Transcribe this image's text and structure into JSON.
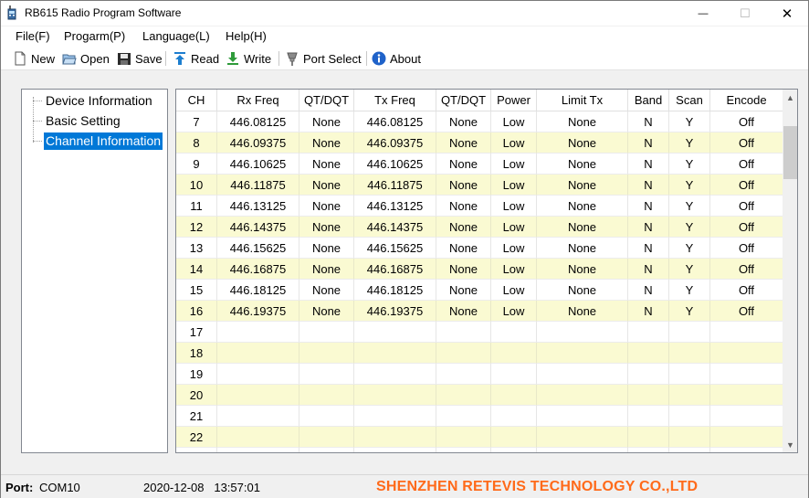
{
  "window": {
    "title": "RB615 Radio Program Software",
    "minimize_glyph": "—",
    "maximize_glyph": "☐",
    "close_glyph": "✕"
  },
  "menu": [
    "File(F)",
    "Progarm(P)",
    "Language(L)",
    "Help(H)"
  ],
  "toolbar": {
    "new_label": "New",
    "open_label": "Open",
    "save_label": "Save",
    "read_label": "Read",
    "write_label": "Write",
    "port_select_label": "Port Select",
    "about_label": "About",
    "icons": [
      "new-document-icon",
      "open-folder-icon",
      "save-disk-icon",
      "read-arrow-up-icon",
      "write-arrow-down-icon",
      "port-plug-icon",
      "info-icon"
    ]
  },
  "tree": {
    "items": [
      "Device Information",
      "Basic Setting",
      "Channel Information"
    ],
    "selected": "Channel Information"
  },
  "grid": {
    "headers": [
      "CH",
      "Rx Freq",
      "QT/DQT",
      "Tx Freq",
      "QT/DQT",
      "Power",
      "Limit Tx",
      "Band",
      "Scan",
      "Encode"
    ],
    "rows": [
      [
        "7",
        "446.08125",
        "None",
        "446.08125",
        "None",
        "Low",
        "None",
        "N",
        "Y",
        "Off"
      ],
      [
        "8",
        "446.09375",
        "None",
        "446.09375",
        "None",
        "Low",
        "None",
        "N",
        "Y",
        "Off"
      ],
      [
        "9",
        "446.10625",
        "None",
        "446.10625",
        "None",
        "Low",
        "None",
        "N",
        "Y",
        "Off"
      ],
      [
        "10",
        "446.11875",
        "None",
        "446.11875",
        "None",
        "Low",
        "None",
        "N",
        "Y",
        "Off"
      ],
      [
        "11",
        "446.13125",
        "None",
        "446.13125",
        "None",
        "Low",
        "None",
        "N",
        "Y",
        "Off"
      ],
      [
        "12",
        "446.14375",
        "None",
        "446.14375",
        "None",
        "Low",
        "None",
        "N",
        "Y",
        "Off"
      ],
      [
        "13",
        "446.15625",
        "None",
        "446.15625",
        "None",
        "Low",
        "None",
        "N",
        "Y",
        "Off"
      ],
      [
        "14",
        "446.16875",
        "None",
        "446.16875",
        "None",
        "Low",
        "None",
        "N",
        "Y",
        "Off"
      ],
      [
        "15",
        "446.18125",
        "None",
        "446.18125",
        "None",
        "Low",
        "None",
        "N",
        "Y",
        "Off"
      ],
      [
        "16",
        "446.19375",
        "None",
        "446.19375",
        "None",
        "Low",
        "None",
        "N",
        "Y",
        "Off"
      ],
      [
        "17",
        "",
        "",
        "",
        "",
        "",
        "",
        "",
        "",
        ""
      ],
      [
        "18",
        "",
        "",
        "",
        "",
        "",
        "",
        "",
        "",
        ""
      ],
      [
        "19",
        "",
        "",
        "",
        "",
        "",
        "",
        "",
        "",
        ""
      ],
      [
        "20",
        "",
        "",
        "",
        "",
        "",
        "",
        "",
        "",
        ""
      ],
      [
        "21",
        "",
        "",
        "",
        "",
        "",
        "",
        "",
        "",
        ""
      ],
      [
        "22",
        "",
        "",
        "",
        "",
        "",
        "",
        "",
        "",
        ""
      ],
      [
        "",
        "",
        "",
        "",
        "",
        "",
        "",
        "",
        "",
        ""
      ]
    ],
    "alt_row_color": "#fafad2",
    "scroll_up_glyph": "▲",
    "scroll_down_glyph": "▼"
  },
  "status": {
    "port_label": "Port:",
    "port_value": "COM10",
    "datetime": "2020-12-08   13:57:01",
    "company": "SHENZHEN RETEVIS TECHNOLOGY CO.,LTD",
    "company_color": "#ff6a1a"
  },
  "colors": {
    "selection": "#0078d7"
  }
}
